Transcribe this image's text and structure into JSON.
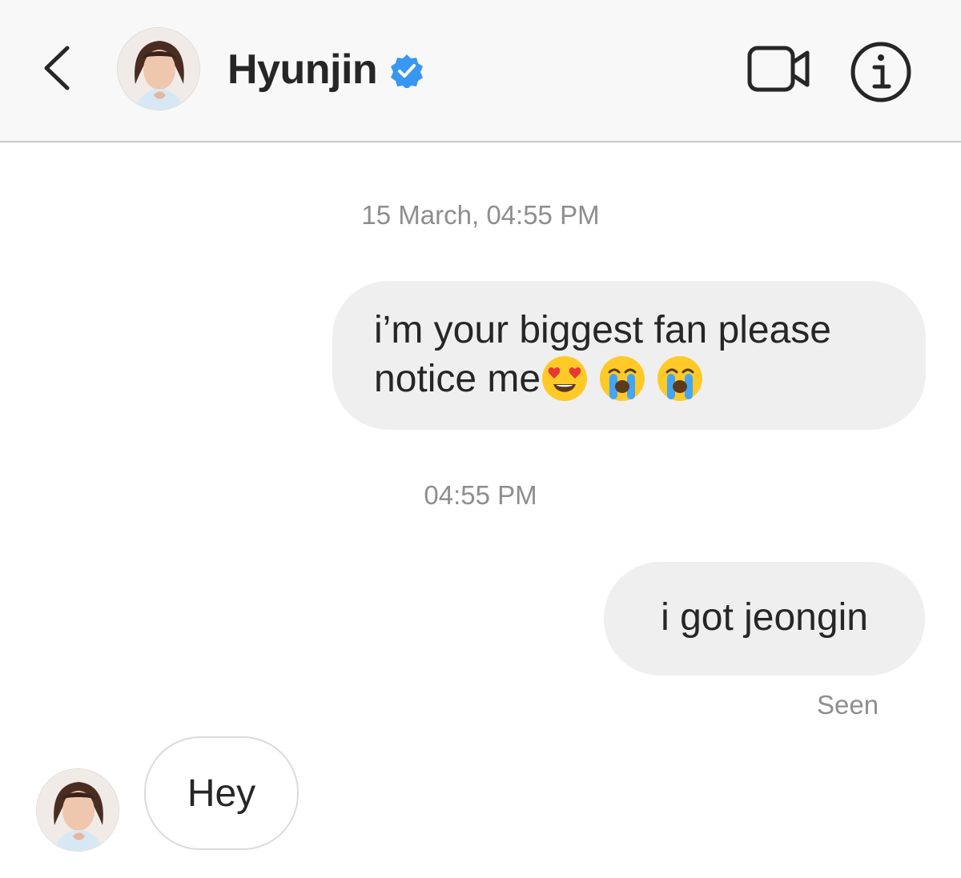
{
  "header": {
    "title": "Hyunjin",
    "verified": true,
    "icons": {
      "back": "chevron-left-icon",
      "avatar": "profile-avatar",
      "verified": "verified-badge-icon",
      "video": "video-camera-icon",
      "info": "info-icon"
    },
    "colors": {
      "verified": "#3897f0",
      "icon": "#262626"
    }
  },
  "thread": {
    "timestamp_1": "15 March, 04:55 PM",
    "messages": [
      {
        "direction": "outgoing",
        "text": "i’m your biggest fan please notice me",
        "emojis": [
          "heart-eyes-emoji",
          "loudly-crying-emoji",
          "loudly-crying-emoji"
        ]
      },
      {
        "direction": "outgoing",
        "text": "i got jeongin"
      },
      {
        "direction": "incoming",
        "text": "Hey"
      }
    ],
    "timestamp_2": "04:55 PM",
    "seen_label": "Seen"
  },
  "colors": {
    "header_bg": "#f8f8f8",
    "bubble_out": "#efefef",
    "bubble_in_border": "#dbdbdb",
    "muted_text": "#8e8e8e",
    "text": "#262626"
  }
}
